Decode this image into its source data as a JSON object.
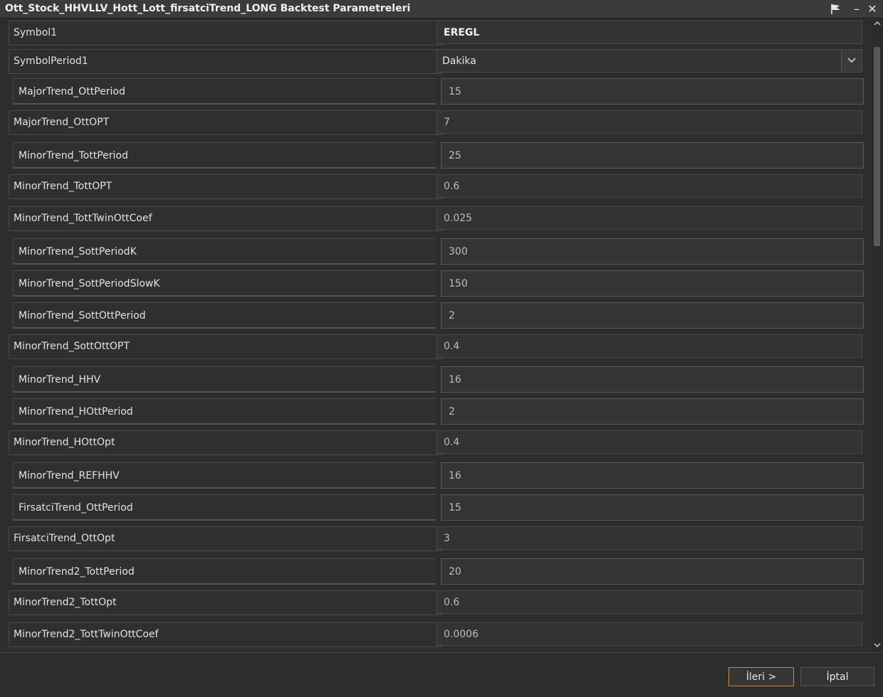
{
  "window": {
    "title": "Ott_Stock_HHVLLV_Hott_Lott_firsatciTrend_LONG Backtest Parametreleri",
    "pin_icon": "pin-icon",
    "minimize_label": "–",
    "close_label": "✕"
  },
  "params": [
    {
      "label": "Symbol1",
      "value": "EREGL"
    },
    {
      "label": "SymbolPeriod1",
      "value": "Dakika"
    },
    {
      "label": "MajorTrend_OttPeriod",
      "value": "15"
    },
    {
      "label": "MajorTrend_OttOPT",
      "value": "7"
    },
    {
      "label": "MinorTrend_TottPeriod",
      "value": "25"
    },
    {
      "label": "MinorTrend_TottOPT",
      "value": "0.6"
    },
    {
      "label": "MinorTrend_TottTwinOttCoef",
      "value": "0.025"
    },
    {
      "label": "MinorTrend_SottPeriodK",
      "value": "300"
    },
    {
      "label": "MinorTrend_SottPeriodSlowK",
      "value": "150"
    },
    {
      "label": "MinorTrend_SottOttPeriod",
      "value": "2"
    },
    {
      "label": "MinorTrend_SottOttOPT",
      "value": "0.4"
    },
    {
      "label": "MinorTrend_HHV",
      "value": "16"
    },
    {
      "label": "MinorTrend_HOttPeriod",
      "value": "2"
    },
    {
      "label": "MinorTrend_HOttOpt",
      "value": "0.4"
    },
    {
      "label": "MinorTrend_REFHHV",
      "value": "16"
    },
    {
      "label": "FirsatciTrend_OttPeriod",
      "value": "15"
    },
    {
      "label": "FirsatciTrend_OttOpt",
      "value": "3"
    },
    {
      "label": "MinorTrend2_TottPeriod",
      "value": "20"
    },
    {
      "label": "MinorTrend2_TottOpt",
      "value": "0.6"
    },
    {
      "label": "MinorTrend2_TottTwinOttCoef",
      "value": "0.0006"
    }
  ],
  "footer": {
    "next_label": "İleri >",
    "cancel_label": "İptal"
  },
  "colors": {
    "accent": "#d48a2a"
  }
}
